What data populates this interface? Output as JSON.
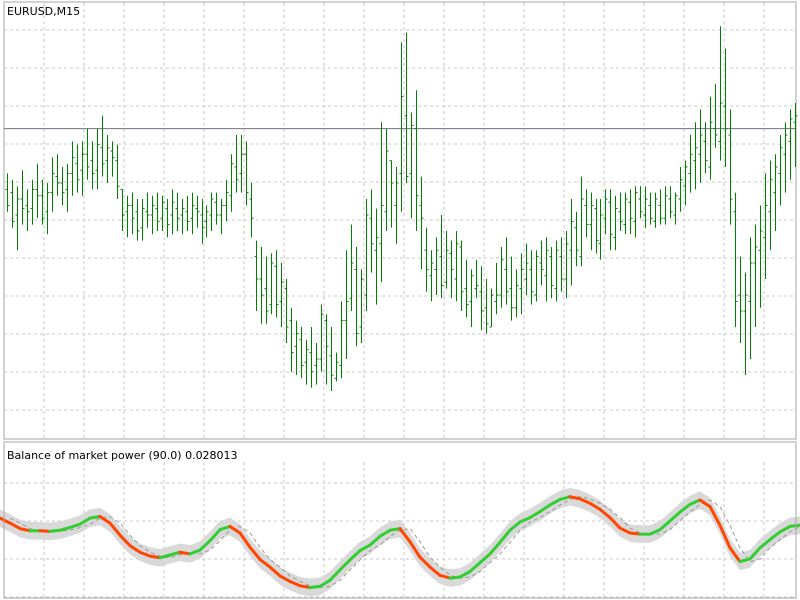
{
  "main_window": {
    "title": "EURUSD,M15"
  },
  "indicator_window": {
    "title": "Balance of market power (90.0) 0.028013"
  },
  "colors": {
    "background": "#ffffff",
    "frame": "#a6a6a6",
    "grid": "#c8c8c8",
    "bar": "#008000",
    "level_line": "#707080",
    "up": "#32cd32",
    "down": "#ff4500",
    "band": "#d9d9d9",
    "dash": "#9a9a9a"
  },
  "chart_data": [
    {
      "type": "ohlc",
      "title": "EURUSD,M15",
      "bar_spacing": "uniform",
      "ylim": [
        0,
        100
      ],
      "horizontal_line": 82,
      "bars": [
        [
          63,
          68,
          56,
          58
        ],
        [
          62,
          66,
          51,
          53
        ],
        [
          55,
          64,
          44,
          60
        ],
        [
          60,
          69,
          52,
          57
        ],
        [
          58,
          63,
          50,
          56
        ],
        [
          57,
          66,
          52,
          63
        ],
        [
          63,
          71,
          54,
          61
        ],
        [
          61,
          66,
          52,
          54
        ],
        [
          56,
          65,
          49,
          62
        ],
        [
          62,
          73,
          56,
          68
        ],
        [
          67,
          74,
          61,
          65
        ],
        [
          65,
          70,
          58,
          62
        ],
        [
          63,
          71,
          56,
          68
        ],
        [
          68,
          78,
          61,
          73
        ],
        [
          71,
          77,
          62,
          66
        ],
        [
          69,
          78,
          61,
          74
        ],
        [
          74,
          82,
          66,
          70
        ],
        [
          72,
          78,
          63,
          68
        ],
        [
          69,
          82,
          63,
          77
        ],
        [
          76,
          86,
          67,
          71
        ],
        [
          72,
          80,
          65,
          76
        ],
        [
          75,
          78,
          67,
          73
        ],
        [
          72,
          77,
          60,
          64
        ],
        [
          63,
          62,
          50,
          55
        ],
        [
          56,
          61,
          48,
          58
        ],
        [
          58,
          62,
          49,
          54
        ],
        [
          56,
          60,
          47,
          50
        ],
        [
          51,
          60,
          47,
          57
        ],
        [
          56,
          62,
          51,
          55
        ],
        [
          55,
          61,
          49,
          58
        ],
        [
          57,
          62,
          50,
          53
        ],
        [
          54,
          61,
          50,
          59
        ],
        [
          57,
          60,
          48,
          52
        ],
        [
          55,
          63,
          49,
          59
        ],
        [
          57,
          62,
          50,
          54
        ],
        [
          55,
          60,
          49,
          57
        ],
        [
          56,
          61,
          50,
          53
        ],
        [
          54,
          62,
          49,
          58
        ],
        [
          57,
          61,
          51,
          56
        ],
        [
          55,
          60,
          46,
          51
        ],
        [
          53,
          58,
          48,
          56
        ],
        [
          55,
          62,
          50,
          60
        ],
        [
          59,
          62,
          52,
          55
        ],
        [
          55,
          60,
          49,
          58
        ],
        [
          58,
          66,
          53,
          62
        ],
        [
          61,
          74,
          56,
          71
        ],
        [
          70,
          80,
          62,
          66
        ],
        [
          68,
          80,
          62,
          74
        ],
        [
          74,
          78,
          58,
          62
        ],
        [
          60,
          65,
          48,
          54
        ],
        [
          42,
          47,
          25,
          35
        ],
        [
          35,
          45,
          21,
          30
        ],
        [
          32,
          42,
          21,
          25
        ],
        [
          27,
          43,
          24,
          40
        ],
        [
          39,
          44,
          23,
          27
        ],
        [
          28,
          40,
          20,
          34
        ],
        [
          32,
          35,
          15,
          20
        ],
        [
          22,
          26,
          6,
          12
        ],
        [
          14,
          22,
          5,
          18
        ],
        [
          16,
          20,
          4,
          8
        ],
        [
          9,
          16,
          2,
          13
        ],
        [
          12,
          20,
          1,
          6
        ],
        [
          8,
          15,
          2,
          10
        ],
        [
          10,
          27,
          6,
          24
        ],
        [
          22,
          24,
          2,
          14
        ],
        [
          11,
          20,
          0,
          5
        ],
        [
          4,
          12,
          3,
          9
        ],
        [
          8,
          28,
          4,
          22
        ],
        [
          22,
          44,
          10,
          28
        ],
        [
          29,
          52,
          25,
          40
        ],
        [
          38,
          45,
          14,
          18
        ],
        [
          20,
          38,
          15,
          35
        ],
        [
          30,
          60,
          25,
          55
        ],
        [
          54,
          63,
          37,
          46
        ],
        [
          44,
          57,
          27,
          48
        ],
        [
          46,
          84,
          34,
          58
        ],
        [
          56,
          82,
          50,
          75
        ],
        [
          72,
          66,
          51,
          65
        ],
        [
          58,
          70,
          46,
          65
        ],
        [
          68,
          109,
          56,
          92
        ],
        [
          86,
          112,
          65,
          67
        ],
        [
          68,
          87,
          54,
          83
        ],
        [
          82,
          94,
          50,
          61
        ],
        [
          58,
          67,
          38,
          54
        ],
        [
          44,
          51,
          31,
          38
        ],
        [
          36,
          44,
          28,
          40
        ],
        [
          38,
          48,
          30,
          44
        ],
        [
          42,
          55,
          29,
          33
        ],
        [
          34,
          50,
          32,
          44
        ],
        [
          43,
          47,
          29,
          38
        ],
        [
          35,
          50,
          28,
          46
        ],
        [
          45,
          47,
          25,
          31
        ],
        [
          32,
          41,
          23,
          27
        ],
        [
          28,
          38,
          20,
          36
        ],
        [
          32,
          41,
          29,
          33
        ],
        [
          31,
          39,
          19,
          25
        ],
        [
          26,
          35,
          18,
          21
        ],
        [
          20,
          32,
          20,
          30
        ],
        [
          28,
          40,
          24,
          30
        ],
        [
          30,
          45,
          26,
          41
        ],
        [
          38,
          48,
          27,
          31
        ],
        [
          32,
          42,
          22,
          26
        ],
        [
          26,
          38,
          23,
          33
        ],
        [
          32,
          43,
          24,
          38
        ],
        [
          35,
          46,
          30,
          40
        ],
        [
          38,
          44,
          27,
          31
        ],
        [
          30,
          44,
          28,
          42
        ],
        [
          40,
          47,
          33,
          38
        ],
        [
          36,
          48,
          28,
          44
        ],
        [
          42,
          45,
          29,
          33
        ],
        [
          32,
          47,
          28,
          44
        ],
        [
          42,
          48,
          31,
          35
        ],
        [
          35,
          50,
          29,
          46
        ],
        [
          44,
          60,
          33,
          53
        ],
        [
          51,
          56,
          39,
          44
        ],
        [
          42,
          67,
          39,
          60
        ],
        [
          58,
          63,
          48,
          52
        ],
        [
          52,
          62,
          44,
          58
        ],
        [
          57,
          60,
          43,
          47
        ],
        [
          46,
          60,
          41,
          55
        ],
        [
          54,
          63,
          49,
          60
        ],
        [
          59,
          63,
          44,
          49
        ],
        [
          48,
          61,
          44,
          57
        ],
        [
          56,
          62,
          50,
          53
        ],
        [
          52,
          62,
          49,
          60
        ],
        [
          59,
          63,
          49,
          54
        ],
        [
          53,
          64,
          48,
          62
        ],
        [
          60,
          64,
          54,
          56
        ],
        [
          55,
          64,
          51,
          60
        ],
        [
          58,
          62,
          52,
          54
        ],
        [
          53,
          62,
          51,
          60
        ],
        [
          58,
          63,
          52,
          54
        ],
        [
          54,
          64,
          52,
          61
        ],
        [
          60,
          64,
          54,
          56
        ],
        [
          55,
          62,
          52,
          61
        ],
        [
          60,
          70,
          56,
          66
        ],
        [
          64,
          72,
          58,
          70
        ],
        [
          68,
          80,
          62,
          74
        ],
        [
          72,
          84,
          63,
          76
        ],
        [
          74,
          88,
          65,
          80
        ],
        [
          78,
          84,
          68,
          72
        ],
        [
          70,
          92,
          66,
          84
        ],
        [
          82,
          96,
          76,
          80
        ],
        [
          78,
          114,
          72,
          90
        ],
        [
          89,
          107,
          70,
          82
        ],
        [
          80,
          88,
          52,
          60
        ],
        [
          56,
          62,
          20,
          28
        ],
        [
          30,
          42,
          15,
          25
        ],
        [
          25,
          37,
          5,
          30
        ],
        [
          28,
          48,
          10,
          40
        ],
        [
          40,
          52,
          20,
          45
        ],
        [
          44,
          58,
          26,
          50
        ],
        [
          48,
          68,
          35,
          58
        ],
        [
          56,
          72,
          44,
          66
        ],
        [
          62,
          74,
          50,
          70
        ],
        [
          68,
          80,
          58,
          76
        ],
        [
          74,
          84,
          62,
          80
        ],
        [
          78,
          88,
          66,
          85
        ],
        [
          84,
          90,
          70,
          86
        ]
      ]
    },
    {
      "type": "line",
      "title": "Balance of market power (90.0) 0.028013",
      "current_value": 0.028013,
      "ylim": [
        -1,
        1
      ],
      "x": [
        0,
        10,
        20,
        30,
        40,
        50,
        60,
        70,
        80,
        90,
        100,
        110,
        120,
        130,
        140,
        150,
        160,
        170,
        180,
        190,
        200,
        210,
        220,
        230,
        240,
        250,
        260,
        270,
        280,
        290,
        300,
        310,
        320,
        330,
        340,
        350,
        360,
        370,
        380,
        390,
        400,
        410,
        420,
        430,
        440,
        450,
        460,
        470,
        480,
        490,
        500,
        510,
        520,
        530,
        540,
        550,
        560,
        570,
        580,
        590,
        600,
        610,
        620,
        630,
        640,
        650,
        660,
        670,
        680,
        690,
        700,
        710,
        720,
        730,
        740,
        750,
        760,
        770,
        780,
        790,
        800
      ],
      "values": [
        0.27,
        0.18,
        0.08,
        0.04,
        0.04,
        0.03,
        0.05,
        0.1,
        0.16,
        0.27,
        0.3,
        0.18,
        -0.04,
        -0.23,
        -0.35,
        -0.42,
        -0.45,
        -0.4,
        -0.35,
        -0.38,
        -0.31,
        -0.14,
        0.06,
        0.12,
        0.0,
        -0.26,
        -0.48,
        -0.62,
        -0.78,
        -0.88,
        -0.96,
        -0.99,
        -0.97,
        -0.86,
        -0.67,
        -0.49,
        -0.32,
        -0.22,
        -0.06,
        0.05,
        0.08,
        -0.16,
        -0.44,
        -0.62,
        -0.77,
        -0.82,
        -0.8,
        -0.7,
        -0.54,
        -0.38,
        -0.17,
        0.05,
        0.2,
        0.28,
        0.39,
        0.51,
        0.61,
        0.66,
        0.62,
        0.54,
        0.43,
        0.28,
        0.09,
        0.0,
        -0.02,
        -0.02,
        0.06,
        0.22,
        0.38,
        0.52,
        0.6,
        0.48,
        0.14,
        -0.27,
        -0.52,
        -0.47,
        -0.27,
        -0.12,
        0.02,
        0.12,
        0.14
      ],
      "band_halfwidth": 0.16,
      "signal_lag": 1
    }
  ]
}
